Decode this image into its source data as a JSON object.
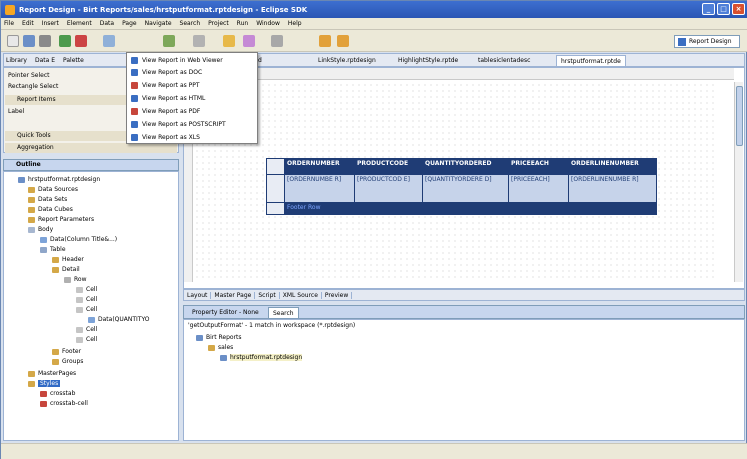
{
  "window": {
    "title": "Report Design - Birt Reports/sales/hrstputformat.rptdesign - Eclipse SDK"
  },
  "menu": [
    "File",
    "Edit",
    "Insert",
    "Element",
    "Data",
    "Page",
    "Navigate",
    "Search",
    "Project",
    "Run",
    "Window",
    "Help"
  ],
  "perspective": {
    "label": "Report Design"
  },
  "palette": {
    "tabs": [
      "Library",
      "Data E",
      "Palette"
    ],
    "items": {
      "pointer": "Pointer Select",
      "rectangle": "Rectangle Select"
    },
    "sections": {
      "report_items": "Report Items",
      "label": "Label",
      "quick_tools": "Quick Tools",
      "aggregation": "Aggregation"
    }
  },
  "view_menu": [
    "View Report in Web Viewer",
    "View Report as DOC",
    "View Report as PPT",
    "View Report as HTML",
    "View Report as PDF",
    "View Report as POSTSCRIPT",
    "View Report as XLS"
  ],
  "editor": {
    "tabs": [
      "d",
      "LinkStyle.rptdesign",
      "HighlightStyle.rptde",
      "tablesiclentadesc",
      "hrstputformat.rptde"
    ],
    "bottom_tabs": [
      "Layout",
      "Master Page",
      "Script",
      "XML Source",
      "Preview"
    ],
    "table": {
      "headers": [
        "ORDERNUMBER",
        "PRODUCTCODE",
        "QUANTITYORDERED",
        "PRICEEACH",
        "ORDERLINENUMBER"
      ],
      "details": [
        "[ORDERNUMBE R]",
        "[PRODUCTCOD E]",
        "[QUANTITYORDERE D]",
        "[PRICEEACH]",
        "[ORDERLINENUMBE R]"
      ],
      "footer": "Footer Row"
    }
  },
  "outline": {
    "title": "Outline",
    "nodes": {
      "root": "hrstputformat.rptdesign",
      "data_sources": "Data Sources",
      "data_sets": "Data Sets",
      "data_cubes": "Data Cubes",
      "report_parameters": "Report Parameters",
      "body": "Body",
      "data1": "Data(Column Title&...)",
      "table": "Table",
      "header": "Header",
      "detail": "Detail",
      "row": "Row",
      "cell": "Cell",
      "data_qty": "Data(QUANTITYO",
      "footer": "Footer",
      "groups": "Groups",
      "master_pages": "MasterPages",
      "styles": "Styles",
      "crosstab": "crosstab",
      "crosstab_cell": "crosstab-cell"
    }
  },
  "bottom_panel": {
    "tabs": [
      "Property Editor - None",
      "Search"
    ],
    "search_summary": "'getOutputFormat' - 1 match in workspace (*.rptdesign)",
    "results": [
      "Birt Reports",
      "sales",
      "hrstputformat.rptdesign"
    ]
  }
}
